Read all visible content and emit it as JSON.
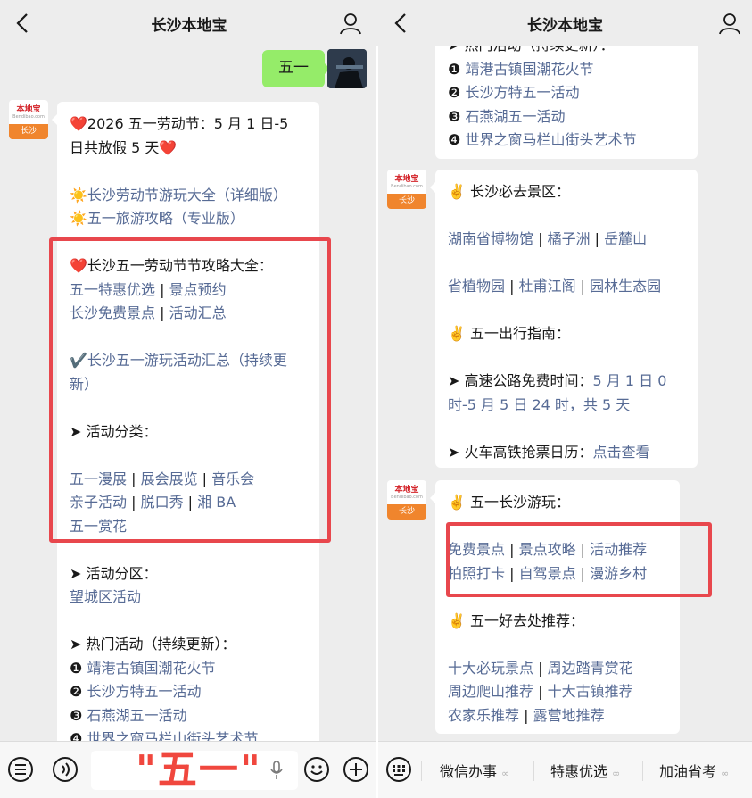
{
  "header": {
    "title": "长沙本地宝"
  },
  "bot_avatar": {
    "logo": "本地宝",
    "sub": "Bendibao.com",
    "city": "长沙"
  },
  "sent_message": "五一",
  "overlay_text": "\"五一\"",
  "left_message": [
    [
      {
        "t": "❤️",
        "c": "heart"
      },
      {
        "t": "2026 五一劳动节：5 月 1 日-5"
      }
    ],
    [
      {
        "t": "日共放假 5 天"
      },
      {
        "t": "❤️",
        "c": "heart"
      }
    ],
    [],
    [
      {
        "t": "☀️",
        "c": "sun"
      },
      {
        "t": "长沙劳动节游玩大全（详细版）",
        "c": "link"
      }
    ],
    [
      {
        "t": "☀️",
        "c": "sun"
      },
      {
        "t": "五一旅游攻略（专业版）",
        "c": "link"
      }
    ],
    [],
    [
      {
        "t": "❤️",
        "c": "heart"
      },
      {
        "t": "长沙五一劳动节节攻略大全："
      }
    ],
    [
      {
        "t": "五一特惠优选",
        "c": "link"
      },
      {
        "t": " | ",
        "c": "sep"
      },
      {
        "t": "景点预约",
        "c": "link"
      }
    ],
    [
      {
        "t": "长沙免费景点",
        "c": "link"
      },
      {
        "t": " | ",
        "c": "sep"
      },
      {
        "t": "活动汇总",
        "c": "link"
      }
    ],
    [],
    [
      {
        "t": "✔️"
      },
      {
        "t": "长沙五一游玩活动汇总（持续更",
        "c": "link"
      }
    ],
    [
      {
        "t": "新）",
        "c": "link"
      }
    ],
    [],
    [
      {
        "t": "➤ 活动分类："
      }
    ],
    [],
    [
      {
        "t": "五一漫展",
        "c": "link"
      },
      {
        "t": " | ",
        "c": "sep"
      },
      {
        "t": "展会展览",
        "c": "link"
      },
      {
        "t": " | ",
        "c": "sep"
      },
      {
        "t": "音乐会",
        "c": "link"
      }
    ],
    [
      {
        "t": "亲子活动",
        "c": "link"
      },
      {
        "t": " | ",
        "c": "sep"
      },
      {
        "t": "脱口秀",
        "c": "link"
      },
      {
        "t": " | ",
        "c": "sep"
      },
      {
        "t": "湘 BA",
        "c": "link"
      }
    ],
    [
      {
        "t": "五一赏花",
        "c": "link"
      }
    ],
    [],
    [
      {
        "t": "➤ 活动分区："
      }
    ],
    [
      {
        "t": "望城区活动",
        "c": "link"
      }
    ],
    [],
    [
      {
        "t": "➤ 热门活动（持续更新）："
      }
    ],
    [
      {
        "t": "❶ "
      },
      {
        "t": "靖港古镇国潮花火节",
        "c": "link"
      }
    ],
    [
      {
        "t": "❷ "
      },
      {
        "t": "长沙方特五一活动",
        "c": "link"
      }
    ],
    [
      {
        "t": "❸ "
      },
      {
        "t": "石燕湖五一活动",
        "c": "link"
      }
    ],
    [
      {
        "t": "❹ "
      },
      {
        "t": "世界之窗马栏山街头艺术节",
        "c": "link"
      }
    ]
  ],
  "right_message_1": [
    [
      {
        "t": "➤ 热门活动（持续更新）："
      }
    ],
    [
      {
        "t": "❶ "
      },
      {
        "t": "靖港古镇国潮花火节",
        "c": "link"
      }
    ],
    [
      {
        "t": "❷ "
      },
      {
        "t": "长沙方特五一活动",
        "c": "link"
      }
    ],
    [
      {
        "t": "❸ "
      },
      {
        "t": "石燕湖五一活动",
        "c": "link"
      }
    ],
    [
      {
        "t": "❹ "
      },
      {
        "t": "世界之窗马栏山街头艺术节",
        "c": "link"
      }
    ]
  ],
  "right_message_2": [
    [
      {
        "t": "✌️ 长沙必去景区："
      }
    ],
    [],
    [
      {
        "t": "湖南省博物馆",
        "c": "link"
      },
      {
        "t": " | ",
        "c": "sep"
      },
      {
        "t": "橘子洲",
        "c": "link"
      },
      {
        "t": " | ",
        "c": "sep"
      },
      {
        "t": "岳麓山",
        "c": "link"
      }
    ],
    [],
    [
      {
        "t": "省植物园",
        "c": "link"
      },
      {
        "t": " | ",
        "c": "sep"
      },
      {
        "t": "杜甫江阁",
        "c": "link"
      },
      {
        "t": " | ",
        "c": "sep"
      },
      {
        "t": "园林生态园",
        "c": "link"
      }
    ],
    [],
    [
      {
        "t": "✌️ 五一出行指南："
      }
    ],
    [],
    [
      {
        "t": "➤ 高速公路免费时间："
      },
      {
        "t": "5 月 1 日 0",
        "c": "link"
      }
    ],
    [
      {
        "t": "时-5 月 5 日 24 时，共 5 天",
        "c": "link"
      }
    ],
    [],
    [
      {
        "t": "➤ 火车高铁抢票日历："
      },
      {
        "t": "点击查看",
        "c": "link"
      }
    ]
  ],
  "right_message_3": [
    [
      {
        "t": "✌️ 五一长沙游玩："
      }
    ],
    [],
    [
      {
        "t": "免费景点",
        "c": "link"
      },
      {
        "t": " | ",
        "c": "sep"
      },
      {
        "t": "景点攻略",
        "c": "link"
      },
      {
        "t": " | ",
        "c": "sep"
      },
      {
        "t": "活动推荐",
        "c": "link"
      }
    ],
    [
      {
        "t": "拍照打卡",
        "c": "link"
      },
      {
        "t": " | ",
        "c": "sep"
      },
      {
        "t": "自驾景点",
        "c": "link"
      },
      {
        "t": " | ",
        "c": "sep"
      },
      {
        "t": "漫游乡村",
        "c": "link"
      }
    ],
    [],
    [
      {
        "t": "✌️ 五一好去处推荐："
      }
    ],
    [],
    [
      {
        "t": "十大必玩景点",
        "c": "link"
      },
      {
        "t": " | ",
        "c": "sep"
      },
      {
        "t": "周边踏青赏花",
        "c": "link"
      }
    ],
    [
      {
        "t": "周边爬山推荐",
        "c": "link"
      },
      {
        "t": " | ",
        "c": "sep"
      },
      {
        "t": "十大古镇推荐",
        "c": "link"
      }
    ],
    [
      {
        "t": "农家乐推荐",
        "c": "link"
      },
      {
        "t": " | ",
        "c": "sep"
      },
      {
        "t": "露营地推荐",
        "c": "link"
      }
    ]
  ],
  "menu": [
    {
      "label": "微信办事"
    },
    {
      "label": "特惠优选"
    },
    {
      "label": "加油省考"
    }
  ],
  "link_glyph": "∞",
  "icons": [
    "back-icon",
    "user-icon",
    "menu-icon",
    "voice-icon",
    "mic-icon",
    "emoji-icon",
    "plus-icon",
    "keyboard-icon"
  ]
}
